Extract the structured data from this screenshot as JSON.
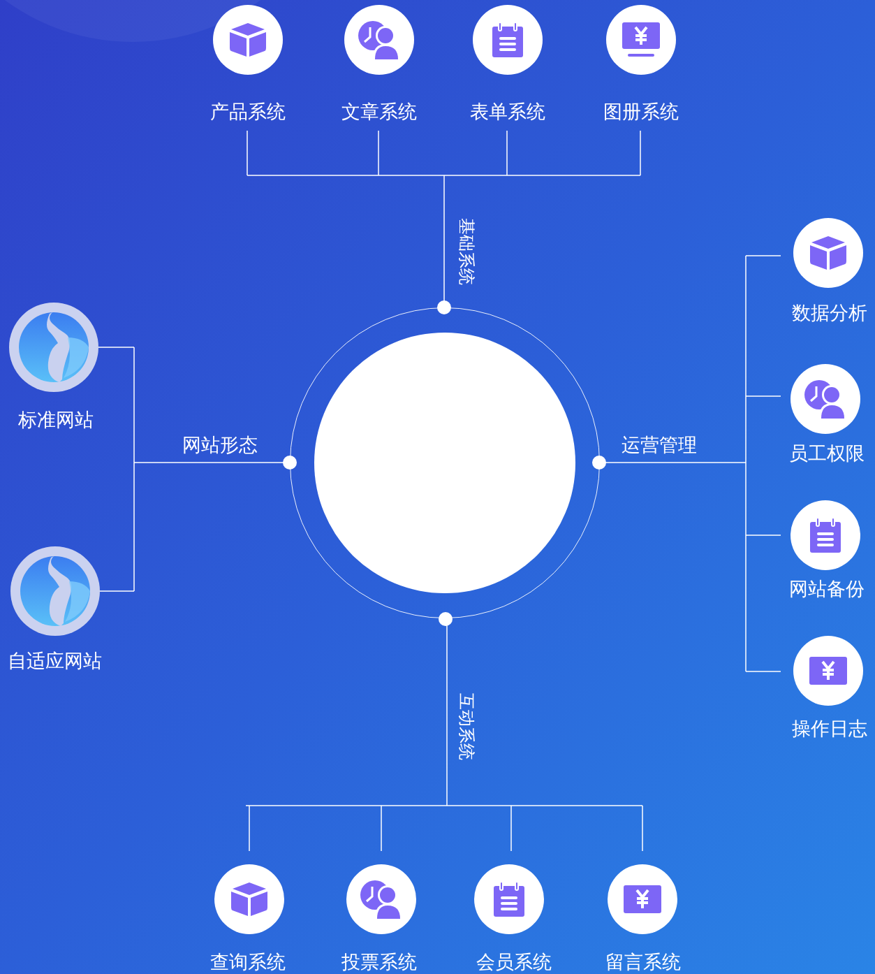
{
  "top": {
    "label": "基础系统",
    "items": [
      {
        "label": "产品系统",
        "kind": "cube"
      },
      {
        "label": "文章系统",
        "kind": "clock-user"
      },
      {
        "label": "表单系统",
        "kind": "notepad"
      },
      {
        "label": "图册系统",
        "kind": "yen-monitor"
      }
    ]
  },
  "left": {
    "label": "网站形态",
    "items": [
      {
        "label": "标准网站",
        "kind": "logo"
      },
      {
        "label": "自适应网站",
        "kind": "logo"
      }
    ]
  },
  "right": {
    "label": "运营管理",
    "items": [
      {
        "label": "数据分析",
        "kind": "cube"
      },
      {
        "label": "员工权限",
        "kind": "clock-user"
      },
      {
        "label": "网站备份",
        "kind": "notepad"
      },
      {
        "label": "操作日志",
        "kind": "yen-card"
      }
    ]
  },
  "bottom": {
    "label": "互动系统",
    "items": [
      {
        "label": "查询系统",
        "kind": "cube"
      },
      {
        "label": "投票系统",
        "kind": "clock-user"
      },
      {
        "label": "会员系统",
        "kind": "notepad"
      },
      {
        "label": "留言系统",
        "kind": "yen-card"
      }
    ]
  }
}
